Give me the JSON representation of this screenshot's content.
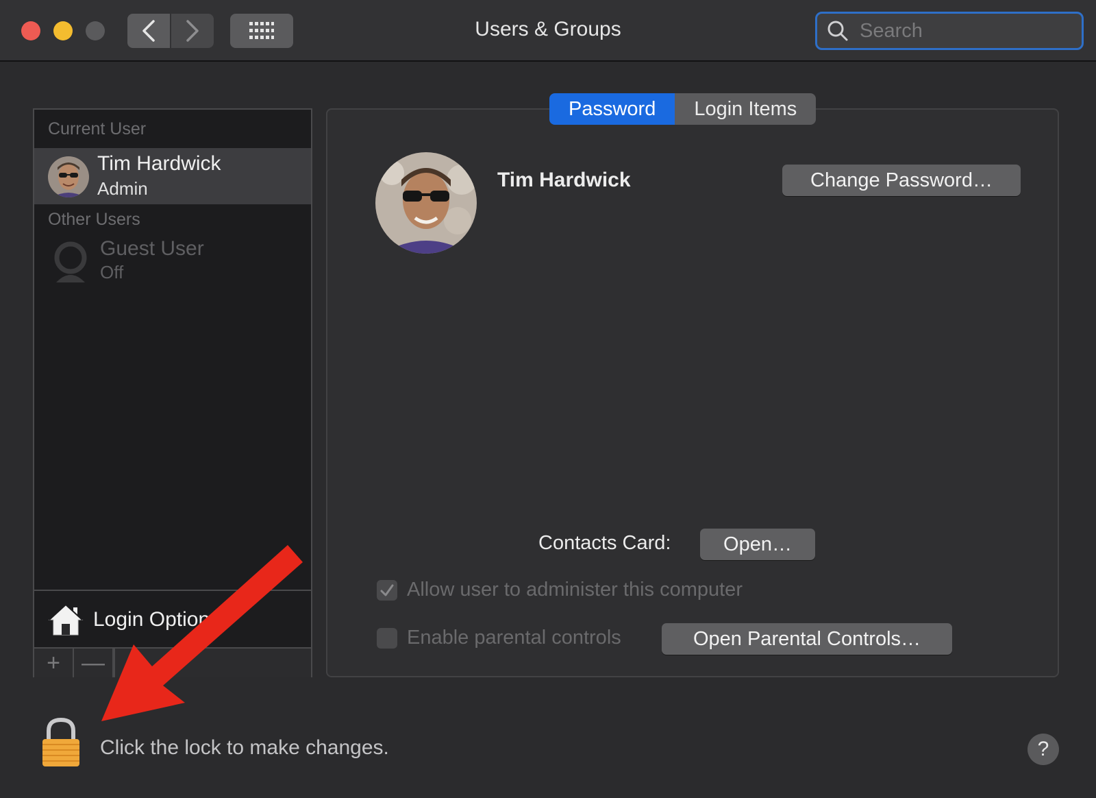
{
  "window": {
    "title": "Users & Groups",
    "search_placeholder": "Search"
  },
  "sidebar": {
    "current_user_label": "Current User",
    "current_user": {
      "name": "Tim Hardwick",
      "role": "Admin"
    },
    "other_users_label": "Other Users",
    "guest": {
      "name": "Guest User",
      "status": "Off"
    },
    "login_options_label": "Login Options",
    "add_label": "+",
    "remove_label": "—"
  },
  "tabs": [
    {
      "label": "Password",
      "active": true
    },
    {
      "label": "Login Items",
      "active": false
    }
  ],
  "main": {
    "user_name": "Tim Hardwick",
    "change_password_label": "Change Password…",
    "contacts_card_label": "Contacts Card:",
    "open_label": "Open…",
    "allow_admin_label": "Allow user to administer this computer",
    "allow_admin_checked": true,
    "parental_controls_label": "Enable parental controls",
    "parental_controls_checked": false,
    "open_parental_label": "Open Parental Controls…"
  },
  "footer": {
    "lock_text": "Click the lock to make changes.",
    "help_label": "?"
  },
  "colors": {
    "accent": "#1a6ae0",
    "annotation_arrow": "#e8271a",
    "lock": "#f0a83a"
  }
}
